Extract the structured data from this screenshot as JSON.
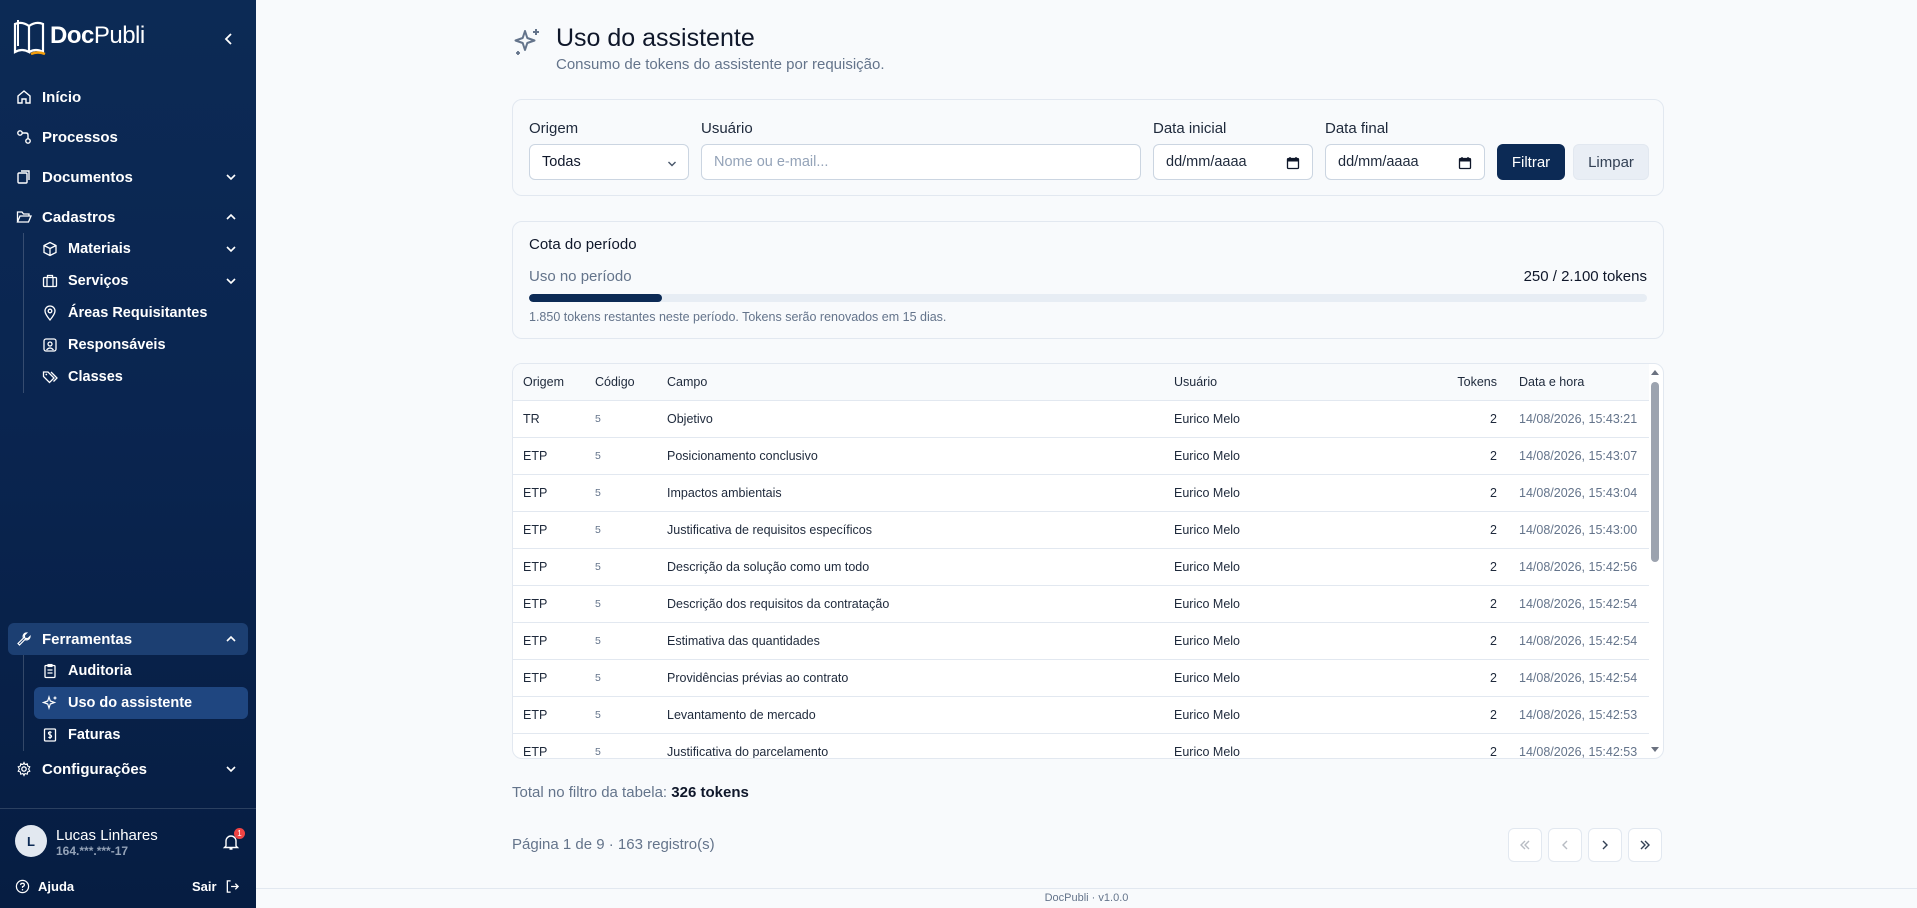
{
  "app": {
    "name_bold": "Doc",
    "name_rest": "Publi"
  },
  "sidebar": {
    "items": [
      {
        "label": "Início"
      },
      {
        "label": "Processos"
      },
      {
        "label": "Documentos"
      },
      {
        "label": "Cadastros"
      }
    ],
    "cadastros_sub": [
      {
        "label": "Materiais"
      },
      {
        "label": "Serviços"
      },
      {
        "label": "Áreas Requisitantes"
      },
      {
        "label": "Responsáveis"
      },
      {
        "label": "Classes"
      }
    ],
    "ferramentas": {
      "label": "Ferramentas"
    },
    "ferramentas_sub": [
      {
        "label": "Auditoria"
      },
      {
        "label": "Uso do assistente"
      },
      {
        "label": "Faturas"
      }
    ],
    "configuracoes": {
      "label": "Configurações"
    }
  },
  "user": {
    "initial": "L",
    "name": "Lucas Linhares",
    "id": "164.***.***-17",
    "notifications": "1",
    "help_label": "Ajuda",
    "logout_label": "Sair"
  },
  "page": {
    "title": "Uso do assistente",
    "subtitle": "Consumo de tokens do assistente por requisição."
  },
  "filters": {
    "origem_label": "Origem",
    "origem_value": "Todas",
    "usuario_label": "Usuário",
    "usuario_placeholder": "Nome ou e-mail...",
    "data_inicial_label": "Data inicial",
    "data_inicial_placeholder": "dd/mm/aaaa",
    "data_final_label": "Data final",
    "data_final_placeholder": "dd/mm/aaaa",
    "filter_button": "Filtrar",
    "clear_button": "Limpar"
  },
  "quota": {
    "title": "Cota do período",
    "usage_label": "Uso no período",
    "usage_value": "250 / 2.100 tokens",
    "used_fraction": 0.119,
    "note": "1.850 tokens restantes neste período. Tokens serão renovados em 15 dias."
  },
  "table": {
    "headers": {
      "origem": "Origem",
      "codigo": "Código",
      "campo": "Campo",
      "usuario": "Usuário",
      "tokens": "Tokens",
      "data": "Data e hora"
    },
    "rows": [
      {
        "origem": "TR",
        "codigo": "5",
        "campo": "Objetivo",
        "usuario": "Eurico Melo",
        "tokens": "2",
        "data": "14/08/2026, 15:43:21"
      },
      {
        "origem": "ETP",
        "codigo": "5",
        "campo": "Posicionamento conclusivo",
        "usuario": "Eurico Melo",
        "tokens": "2",
        "data": "14/08/2026, 15:43:07"
      },
      {
        "origem": "ETP",
        "codigo": "5",
        "campo": "Impactos ambientais",
        "usuario": "Eurico Melo",
        "tokens": "2",
        "data": "14/08/2026, 15:43:04"
      },
      {
        "origem": "ETP",
        "codigo": "5",
        "campo": "Justificativa de requisitos específicos",
        "usuario": "Eurico Melo",
        "tokens": "2",
        "data": "14/08/2026, 15:43:00"
      },
      {
        "origem": "ETP",
        "codigo": "5",
        "campo": "Descrição da solução como um todo",
        "usuario": "Eurico Melo",
        "tokens": "2",
        "data": "14/08/2026, 15:42:56"
      },
      {
        "origem": "ETP",
        "codigo": "5",
        "campo": "Descrição dos requisitos da contratação",
        "usuario": "Eurico Melo",
        "tokens": "2",
        "data": "14/08/2026, 15:42:54"
      },
      {
        "origem": "ETP",
        "codigo": "5",
        "campo": "Estimativa das quantidades",
        "usuario": "Eurico Melo",
        "tokens": "2",
        "data": "14/08/2026, 15:42:54"
      },
      {
        "origem": "ETP",
        "codigo": "5",
        "campo": "Providências prévias ao contrato",
        "usuario": "Eurico Melo",
        "tokens": "2",
        "data": "14/08/2026, 15:42:54"
      },
      {
        "origem": "ETP",
        "codigo": "5",
        "campo": "Levantamento de mercado",
        "usuario": "Eurico Melo",
        "tokens": "2",
        "data": "14/08/2026, 15:42:53"
      },
      {
        "origem": "ETP",
        "codigo": "5",
        "campo": "Justificativa do parcelamento",
        "usuario": "Eurico Melo",
        "tokens": "2",
        "data": "14/08/2026, 15:42:53"
      }
    ]
  },
  "summary": {
    "total_label": "Total no filtro da tabela:",
    "total_value": "326 tokens",
    "page_info": "Página 1 de 9 · 163 registro(s)"
  },
  "footer": {
    "text": "DocPubli · v1.0.0"
  },
  "colors": {
    "sidebar": "#0c2a55",
    "accent": "#0c2a55",
    "background": "#f8fafc"
  }
}
